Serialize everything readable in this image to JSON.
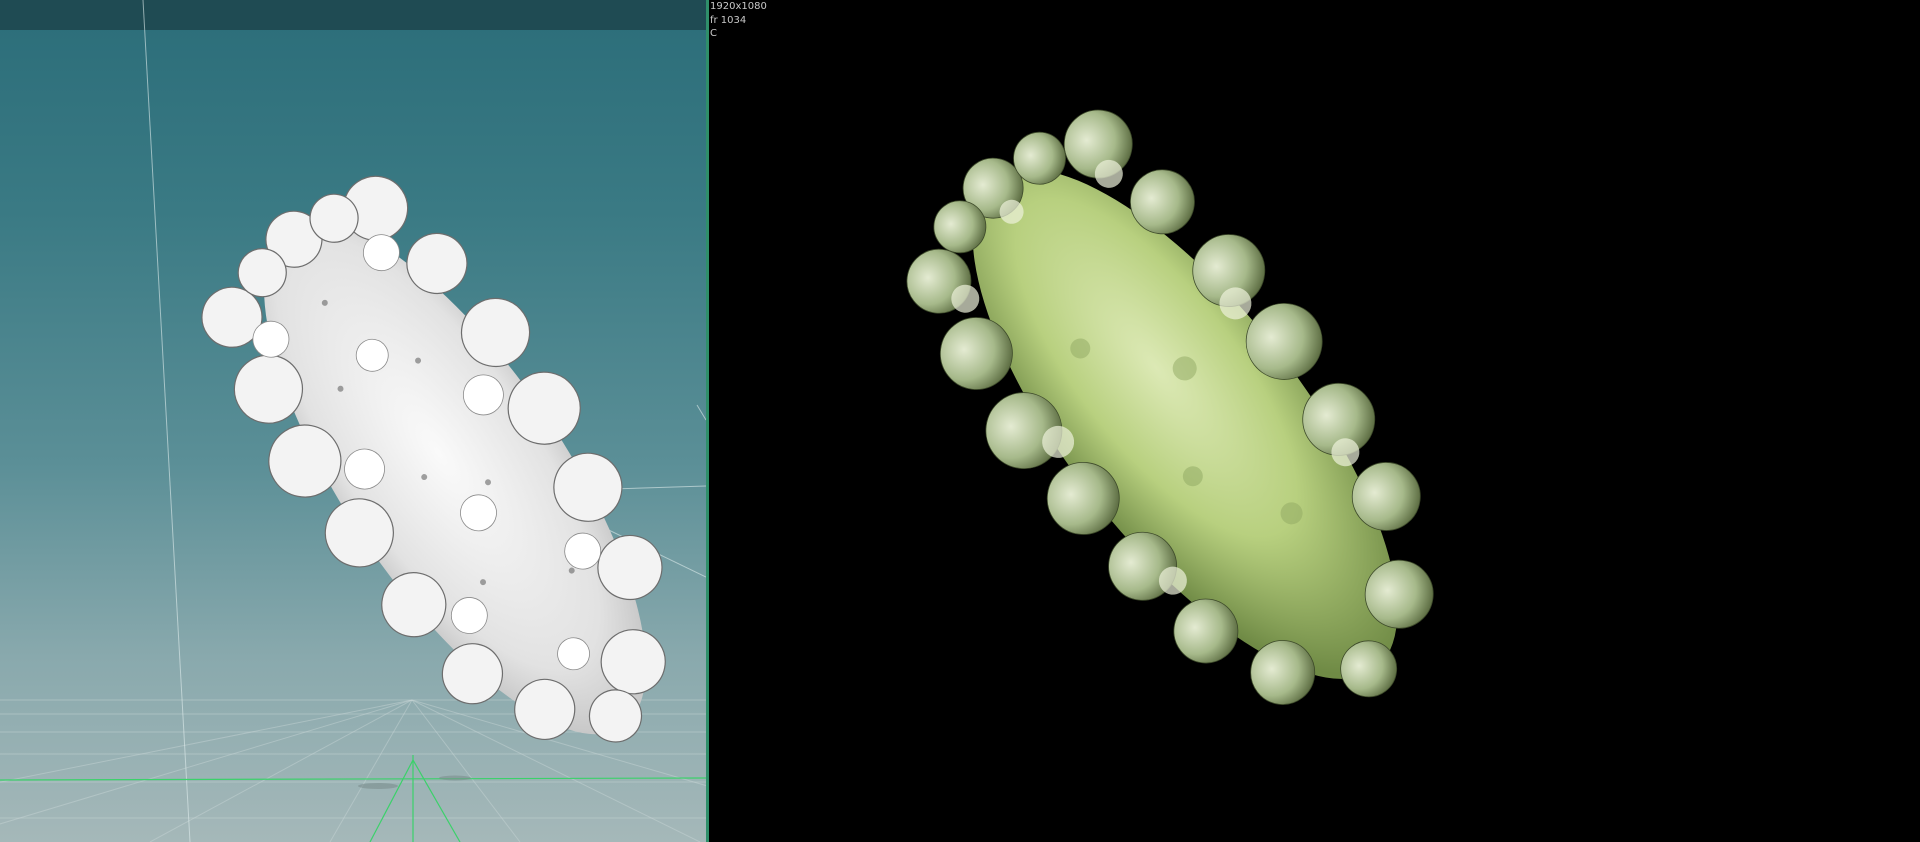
{
  "render_view": {
    "resolution": "1920x1080",
    "frame": "fr 1034",
    "camera": "C"
  },
  "colors": {
    "viewport_top": "#2b6d79",
    "viewport_bottom": "#a5b8b9",
    "divider": "#2f8f6a",
    "coral_viewport": "#e8e8e8",
    "coral_render": "#b9d38a"
  }
}
